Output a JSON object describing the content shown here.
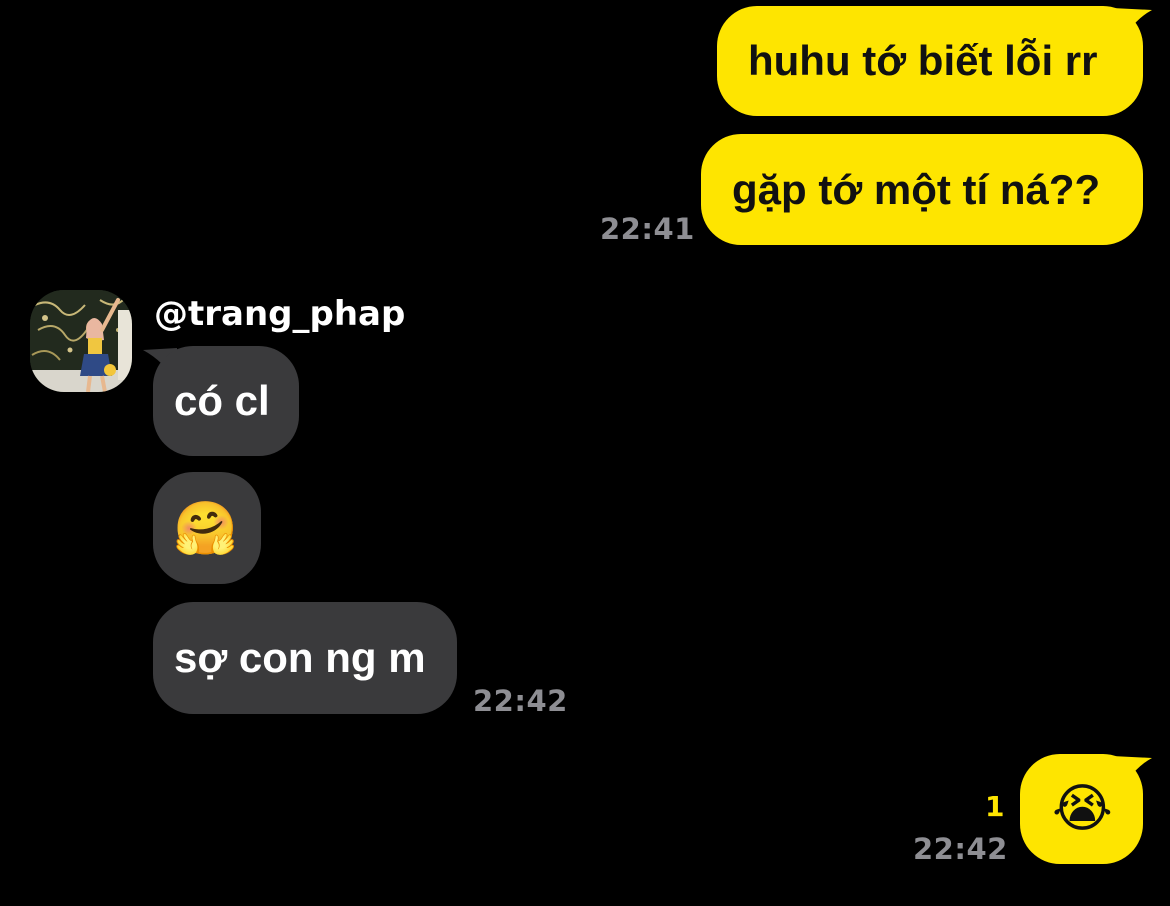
{
  "messages": {
    "sent_1": "huhu tớ biết lỗi rr",
    "sent_2": "gặp tớ một tí ná??",
    "sent_time_1": "22:41",
    "received_1": "có cl",
    "received_2_emoji": "🤗",
    "received_3": "sợ con ng m",
    "received_time": "22:42",
    "sent_3_emoji": "😭",
    "sent_unread_count": "1",
    "sent_time_2": "22:42"
  },
  "contact": {
    "username": "@trang_phap",
    "avatar_icon": "user-photo-avatar"
  },
  "colors": {
    "background": "#000000",
    "sent_bubble": "#fee500",
    "received_bubble": "#3a3a3c",
    "timestamp": "#8e8e93",
    "unread_count": "#fee500"
  }
}
